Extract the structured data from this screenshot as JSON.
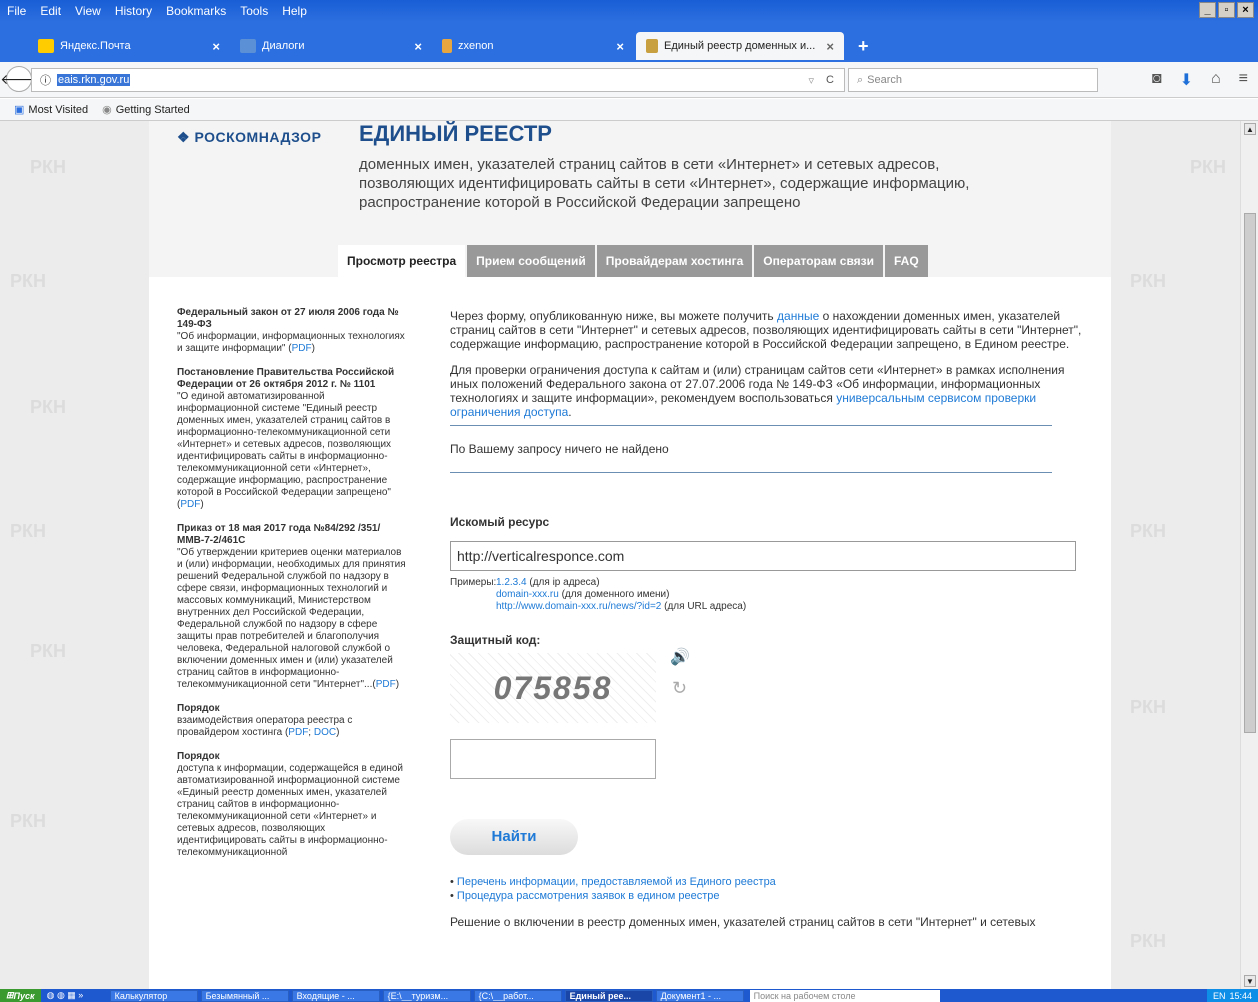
{
  "menubar": {
    "items": [
      "File",
      "Edit",
      "View",
      "History",
      "Bookmarks",
      "Tools",
      "Help"
    ]
  },
  "tabs": [
    {
      "label": "Яндекс.Почта",
      "color": "#ffcc00"
    },
    {
      "label": "Диалоги",
      "color": "#5b8fd6"
    },
    {
      "label": "zxenon",
      "color": "#e8a640"
    },
    {
      "label": "Единый реестр доменных и...",
      "color": "#c8a040"
    }
  ],
  "nav": {
    "url": "eais.rkn.gov.ru",
    "search_placeholder": "Search"
  },
  "bookmarks": [
    "Most Visited",
    "Getting Started"
  ],
  "watermark": "РКН",
  "header": {
    "logo": "РОСКОМНАДЗОР",
    "title": "ЕДИНЫЙ РЕЕСТР",
    "subtitle": "доменных имен, указателей страниц сайтов в сети «Интернет» и сетевых адресов, позволяющих идентифицировать сайты в сети «Интернет», содержащие информацию, распространение которой в Российской Федерации запрещено"
  },
  "navtabs": [
    "Просмотр реестра",
    "Прием сообщений",
    "Провайдерам хостинга",
    "Операторам связи",
    "FAQ"
  ],
  "left": {
    "b1_title": "Федеральный закон от 27 июля 2006 года № 149-ФЗ",
    "b1_text": "\"Об информации, информационных технологиях и защите информации\" (",
    "b2_title": "Постановление Правительства Российской Федерации от 26 октября 2012 г. № 1101",
    "b2_text": "\"О единой автоматизированной информационной системе \"Единый реестр доменных имен, указателей страниц сайтов в информационно-телекоммуникационной сети «Интернет» и сетевых адресов, позволяющих идентифицировать сайты в информационно-телекоммуникационной сети «Интернет», содержащие информацию, распространение которой в Российской Федерации запрещено\" (",
    "b3_title": "Приказ от 18 мая 2017 года №84/292 /351/ММВ-7-2/461С",
    "b3_text": "\"Об утверждении критериев оценки материалов и (или) информации, необходимых для принятия решений Федеральной службой по надзору в сфере связи, информационных технологий и массовых коммуникаций, Министерством внутренних дел Российской Федерации, Федеральной службой по надзору в сфере защиты прав потребителей и благополучия человека, Федеральной налоговой службой о включении доменных имен и (или) указателей страниц сайтов в информационно-телекоммуникационной сети \"Интернет\"...(",
    "b4_title": "Порядок",
    "b4_text": "взаимодействия оператора реестра с провайдером хостинга (",
    "b5_title": "Порядок",
    "b5_text": "доступа к информации, содержащейся в единой автоматизированной информационной системе «Единый реестр доменных имен, указателей страниц сайтов в информационно-телекоммуникационной сети «Интернет» и сетевых адресов, позволяющих идентифицировать сайты в информационно-телекоммуникационной",
    "pdf": "PDF",
    "doc": "DOC",
    "close": ")",
    "sep": "; "
  },
  "main": {
    "p1a": "Через форму, опубликованную ниже, вы можете получить ",
    "p1link": "данные",
    "p1b": " о нахождении доменных имен, указателей страниц сайтов в сети \"Интернет\" и сетевых адресов, позволяющих идентифицировать сайты в сети \"Интернет\", содержащие информацию, распространение которой в Российской Федерации запрещено, в Едином реестре.",
    "p2a": "Для проверки ограничения доступа к сайтам и (или) страницам сайтов сети «Интернет» в рамках исполнения иных положений Федерального закона от 27.07.2006 года № 149-ФЗ «Об информации, информационных технологиях и защите информации», рекомендуем воспользоваться ",
    "p2link": "универсальным сервисом проверки ограничения доступа",
    "p2b": ".",
    "notfound": "По Вашему запросу ничего не найдено",
    "resource_label": "Искомый ресурс",
    "resource_value": "http://verticalresponce.com",
    "examples_label": "Примеры:",
    "ex1": "1.2.3.4",
    "ex1d": " (для ip адреса)",
    "ex2": "domain-xxx.ru",
    "ex2d": " (для доменного имени)",
    "ex3": "http://www.domain-xxx.ru/news/?id=2",
    "ex3d": " (для URL адреса)",
    "captcha_label": "Защитный код:",
    "captcha_code": "075858",
    "find_button": "Найти",
    "link1": "Перечень информации, предоставляемой из Единого реестра",
    "link2": "Процедура рассмотрения заявок в едином реестре",
    "bottom": "Решение о включении в реестр доменных имен, указателей страниц сайтов в сети \"Интернет\" и сетевых"
  },
  "taskbar": {
    "start": "Пуск",
    "items": [
      "Калькулятор",
      "Безымянный ...",
      "Входящие - ...",
      "{E:\\__туризм...",
      "{C:\\__работ...",
      "Единый рее...",
      "Документ1 - ..."
    ],
    "search": "Поиск на рабочем столе",
    "lang": "EN",
    "time": "15:44"
  }
}
